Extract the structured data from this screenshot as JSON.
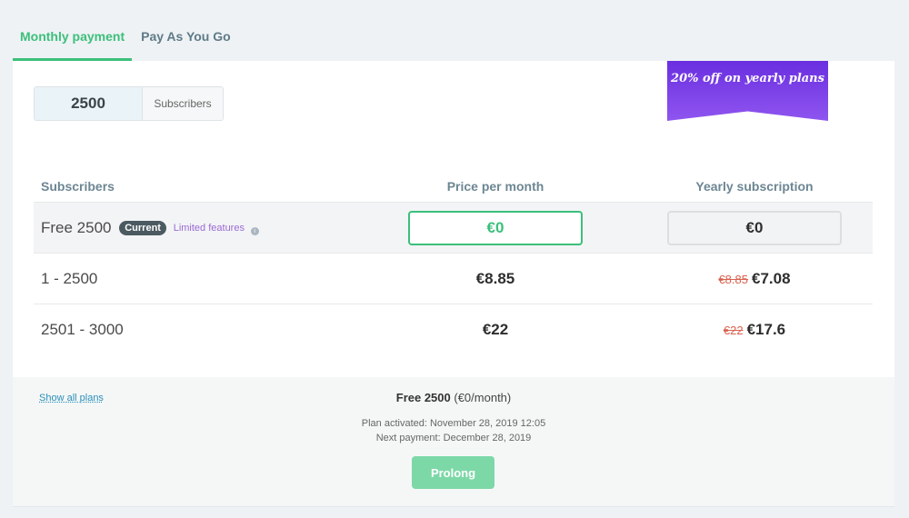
{
  "tabs": [
    {
      "label": "Monthly payment",
      "active": true
    },
    {
      "label": "Pay As You Go",
      "active": false
    }
  ],
  "subscribers_input": {
    "value": "2500",
    "addon": "Subscribers"
  },
  "promo_banner": {
    "text": "20% off on yearly plans",
    "color_from": "#6a2fe0",
    "color_to": "#8f55ef"
  },
  "table": {
    "headers": [
      "Subscribers",
      "Price per month",
      "Yearly subscription"
    ],
    "rows": [
      {
        "subscribers": "Free 2500",
        "badge": "Current",
        "note": "Limited features",
        "monthly": "€0",
        "yearly_old": "",
        "yearly": "€0"
      },
      {
        "subscribers": "1 - 2500",
        "monthly": "€8.85",
        "yearly_old": "€8.85",
        "yearly": "€7.08"
      },
      {
        "subscribers": "2501 - 3000",
        "monthly": "€22",
        "yearly_old": "€22",
        "yearly": "€17.6"
      }
    ]
  },
  "footer": {
    "show_all_link": "Show all plans",
    "plan_name": "Free 2500",
    "plan_price": "(€0/month)",
    "activated": "Plan activated: November 28, 2019 12:05",
    "next_payment": "Next payment: December 28, 2019",
    "prolong_label": "Prolong"
  },
  "colors": {
    "accent": "#3cbf7b",
    "strike": "#d9614e",
    "link": "#2a8fb8"
  }
}
